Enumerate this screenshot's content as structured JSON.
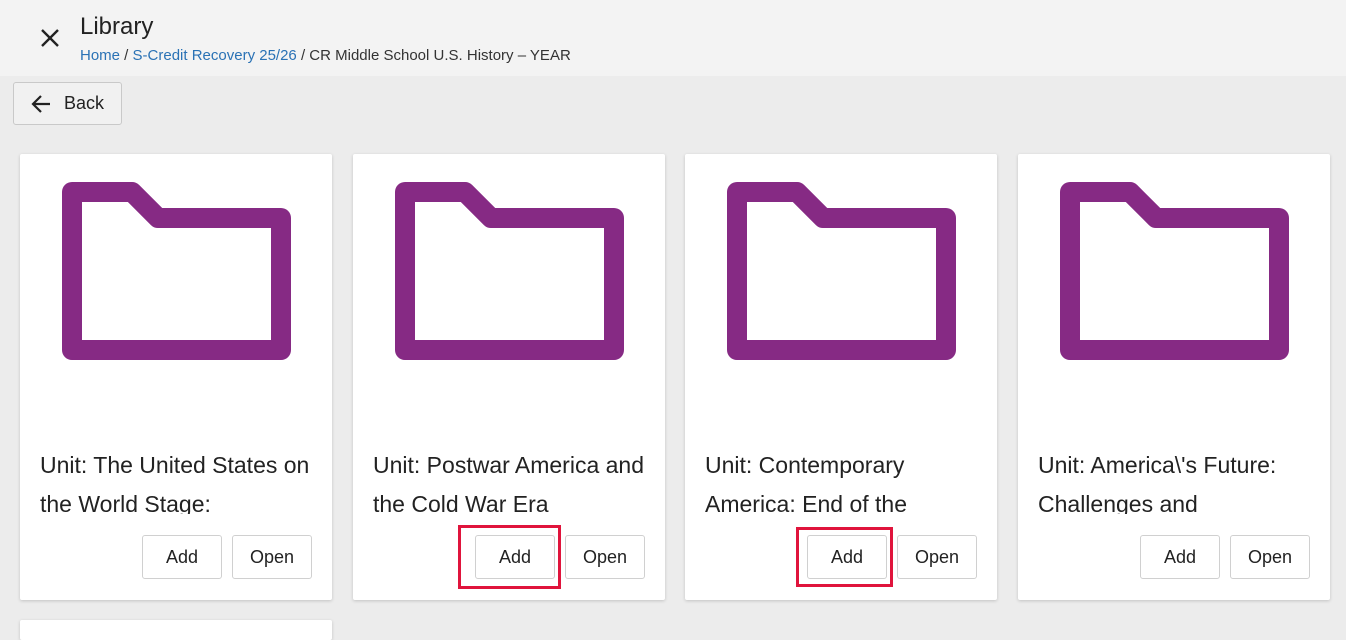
{
  "header": {
    "title": "Library",
    "breadcrumb": {
      "home": "Home",
      "sep1": " / ",
      "course": "S-Credit Recovery 25/26",
      "sep2": " / ",
      "current": "CR Middle School U.S. History – YEAR"
    }
  },
  "back_button": {
    "label": "Back"
  },
  "colors": {
    "folder": "#862a84",
    "link": "#2a72b5",
    "highlight": "#e0143c"
  },
  "cards": [
    {
      "title": "Unit: The United States on the World Stage:",
      "add_label": "Add",
      "open_label": "Open",
      "icon": "folder-icon"
    },
    {
      "title": "Unit: Postwar America and the Cold War Era",
      "add_label": "Add",
      "open_label": "Open",
      "icon": "folder-icon"
    },
    {
      "title": "Unit: Contemporary America: End of the",
      "add_label": "Add",
      "open_label": "Open",
      "icon": "folder-icon"
    },
    {
      "title": "Unit: America\\'s Future: Challenges and",
      "add_label": "Add",
      "open_label": "Open",
      "icon": "folder-icon"
    }
  ]
}
